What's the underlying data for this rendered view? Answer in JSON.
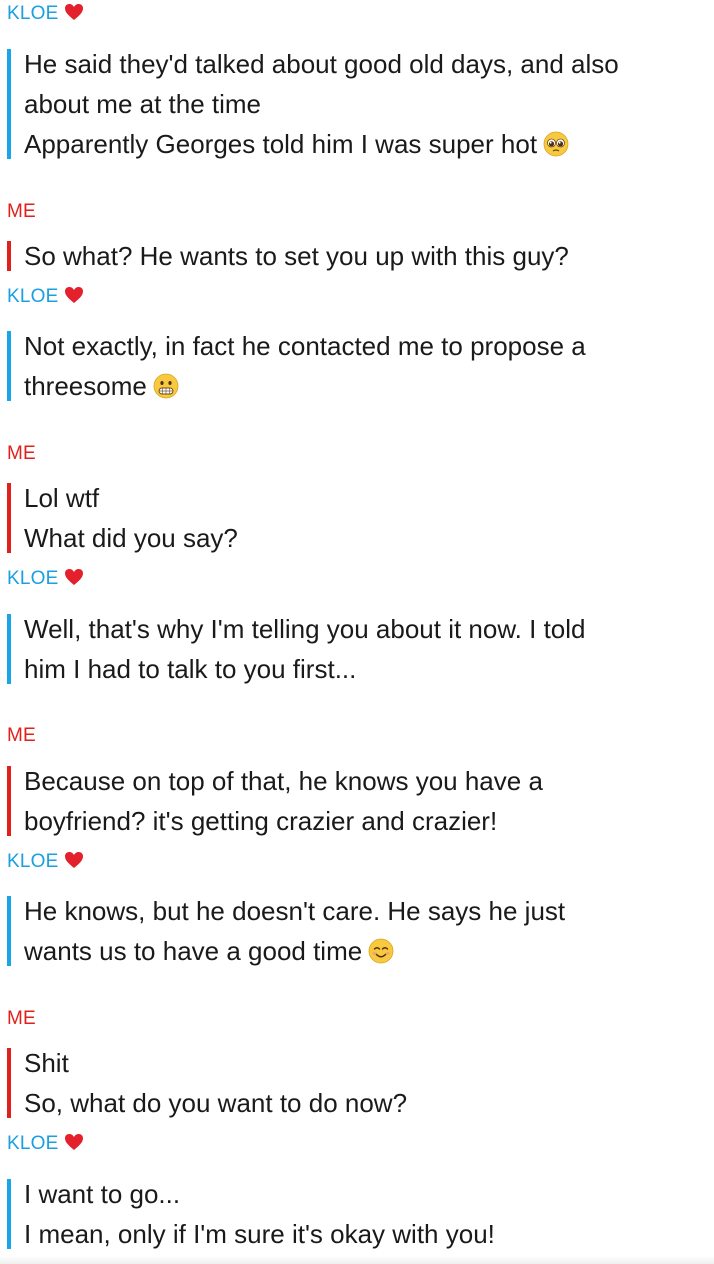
{
  "colors": {
    "kloe_accent": "#1aa5e6",
    "me_accent": "#e0201b",
    "text": "#1a1a1a",
    "background": "#ffffff"
  },
  "senders": {
    "kloe": "KLOE",
    "me": "ME"
  },
  "messages": [
    {
      "sender": "KLOE",
      "lines": [
        "He said they'd talked about good old days, and also",
        "about me at the time",
        "Apparently Georges told him I was super hot"
      ],
      "emoji": "pleading-face-emoji"
    },
    {
      "sender": "ME",
      "lines": [
        "So what? He wants to set you up with this guy?"
      ]
    },
    {
      "sender": "KLOE",
      "lines": [
        "Not exactly, in fact he contacted me to propose a",
        "threesome"
      ],
      "emoji": "grimacing-face-emoji"
    },
    {
      "sender": "ME",
      "lines": [
        "Lol wtf",
        "What did you say?"
      ]
    },
    {
      "sender": "KLOE",
      "lines": [
        "Well, that's why I'm telling you about it now. I told",
        "him I had to talk to you first..."
      ]
    },
    {
      "sender": "ME",
      "lines": [
        "Because on top of that, he knows you have a",
        "boyfriend? it's getting crazier and crazier!"
      ]
    },
    {
      "sender": "KLOE",
      "lines": [
        "He knows, but he doesn't care. He says he just",
        "wants us to have a good time"
      ],
      "emoji": "smiling-face-emoji"
    },
    {
      "sender": "ME",
      "lines": [
        "Shit",
        "So, what do you want to do now?"
      ]
    },
    {
      "sender": "KLOE",
      "lines": [
        "I want to go...",
        "I mean, only if I'm sure it's okay with you!"
      ]
    }
  ]
}
